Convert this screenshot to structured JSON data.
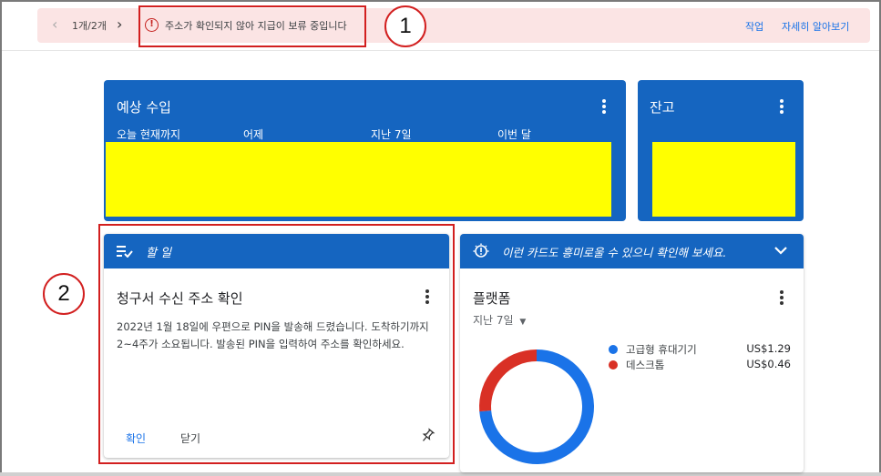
{
  "banner": {
    "pager": "1개/2개",
    "message": "주소가 확인되지 않아 지급이 보류 중입니다",
    "action_1": "작업",
    "action_2": "자세히 알아보기"
  },
  "callouts": {
    "one": "1",
    "two": "2"
  },
  "earnings": {
    "title": "예상 수입",
    "columns": [
      "오늘 현재까지",
      "어제",
      "지난 7일",
      "이번 달"
    ]
  },
  "balance": {
    "title": "잔고"
  },
  "todo": {
    "header": "할 일",
    "title": "청구서 수신 주소 확인",
    "body": "2022년 1월 18일에 우편으로 PIN을 발송해 드렸습니다. 도착하기까지 2~4주가 소요됩니다. 발송된 PIN을 입력하여 주소를 확인하세요.",
    "confirm_label": "확인",
    "close_label": "닫기"
  },
  "promo": {
    "text": "이런 카드도 흥미로울 수 있으니 확인해 보세요.",
    "platform_title": "플랫폼",
    "period": "지난 7일",
    "legend": [
      {
        "label": "고급형 휴대기기",
        "value": "US$1.29",
        "amount": 1.29,
        "color": "#1a73e8"
      },
      {
        "label": "데스크톱",
        "value": "US$0.46",
        "amount": 0.46,
        "color": "#d93025"
      }
    ]
  },
  "colors": {
    "brand_blue": "#1565c0",
    "alert_red": "#d21f1f",
    "highlight": "#ffff00"
  }
}
